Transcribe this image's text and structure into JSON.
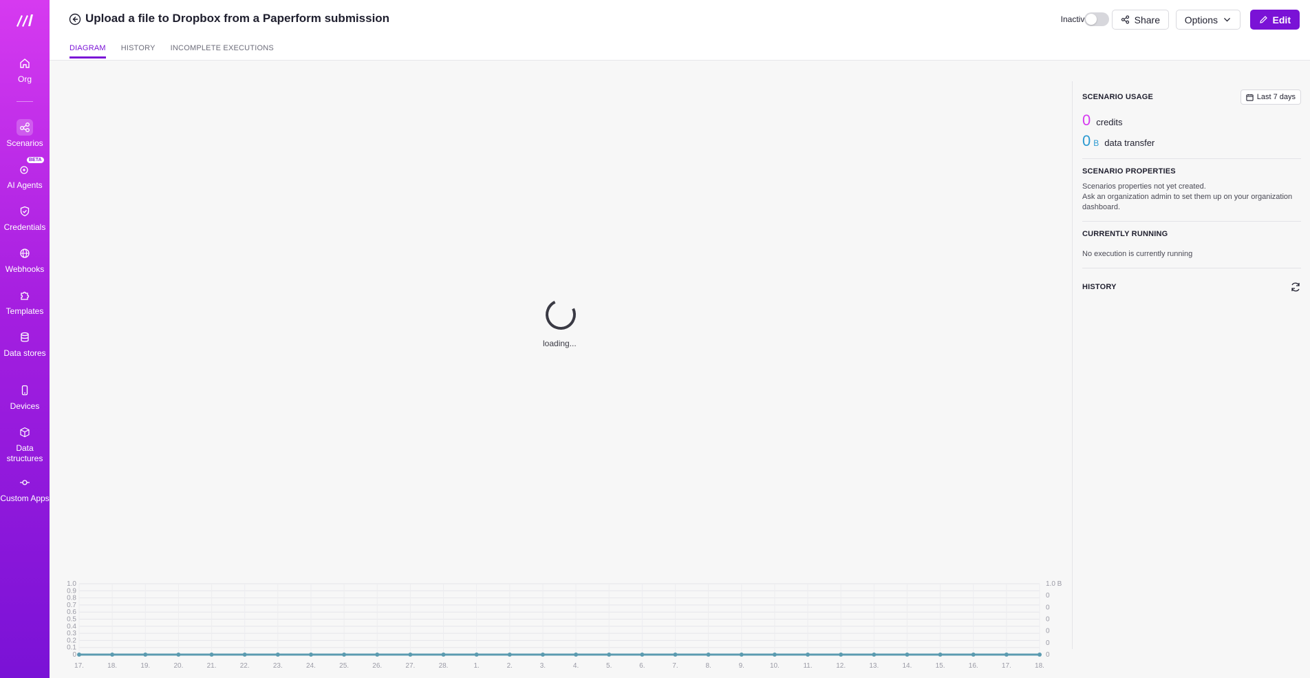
{
  "sidebar": {
    "items": [
      {
        "label": "Org",
        "icon": "home-icon"
      },
      {
        "label": "Scenarios",
        "icon": "share-nodes-icon"
      },
      {
        "label": "AI Agents",
        "icon": "ai-agent-icon",
        "badge": "BETA"
      },
      {
        "label": "Credentials",
        "icon": "shield-check-icon"
      },
      {
        "label": "Webhooks",
        "icon": "globe-icon"
      },
      {
        "label": "Templates",
        "icon": "puzzle-icon"
      },
      {
        "label": "Data stores",
        "icon": "database-icon"
      },
      {
        "label": "Devices",
        "icon": "mobile-icon"
      },
      {
        "label": "Data structures",
        "icon": "cube-icon"
      },
      {
        "label": "Custom Apps",
        "icon": "commit-icon"
      }
    ]
  },
  "header": {
    "title": "Upload a file to Dropbox from a Paperform submission",
    "status_label": "Inactive",
    "share_label": "Share",
    "options_label": "Options",
    "edit_label": "Edit",
    "tabs": [
      "DIAGRAM",
      "HISTORY",
      "INCOMPLETE EXECUTIONS"
    ]
  },
  "main": {
    "loading_text": "loading..."
  },
  "panel": {
    "usage_title": "SCENARIO USAGE",
    "range_label": "Last 7 days",
    "credits_value": "0",
    "credits_label": "credits",
    "transfer_value": "0",
    "transfer_unit": "B",
    "transfer_label": "data transfer",
    "properties_title": "SCENARIO PROPERTIES",
    "properties_line1": "Scenarios properties not yet created.",
    "properties_line2": "Ask an organization admin to set them up on your organization dashboard.",
    "running_title": "CURRENTLY RUNNING",
    "running_text": "No execution is currently running",
    "history_title": "HISTORY"
  },
  "colors": {
    "accent": "#7a12d6",
    "credits": "#d63af0",
    "transfer": "#2c9ad1",
    "series": "#5b9bb0"
  },
  "chart_data": {
    "type": "line",
    "x": [
      "17.",
      "18.",
      "19.",
      "20.",
      "21.",
      "22.",
      "23.",
      "24.",
      "25.",
      "26.",
      "27.",
      "28.",
      "1.",
      "2.",
      "3.",
      "4.",
      "5.",
      "6.",
      "7.",
      "8.",
      "9.",
      "10.",
      "11.",
      "12.",
      "13.",
      "14.",
      "15.",
      "16.",
      "17.",
      "18."
    ],
    "left_ticks": [
      "0",
      "0.1",
      "0.2",
      "0.3",
      "0.4",
      "0.5",
      "0.6",
      "0.7",
      "0.8",
      "0.9",
      "1.0"
    ],
    "right_ticks": [
      "0",
      "0",
      "0",
      "0",
      "0",
      "0",
      "1.0 B"
    ],
    "ylim": [
      0,
      1
    ],
    "series": [
      {
        "values": [
          0,
          0,
          0,
          0,
          0,
          0,
          0,
          0,
          0,
          0,
          0,
          0,
          0,
          0,
          0,
          0,
          0,
          0,
          0,
          0,
          0,
          0,
          0,
          0,
          0,
          0,
          0,
          0,
          0,
          0
        ]
      }
    ],
    "grid": true
  }
}
